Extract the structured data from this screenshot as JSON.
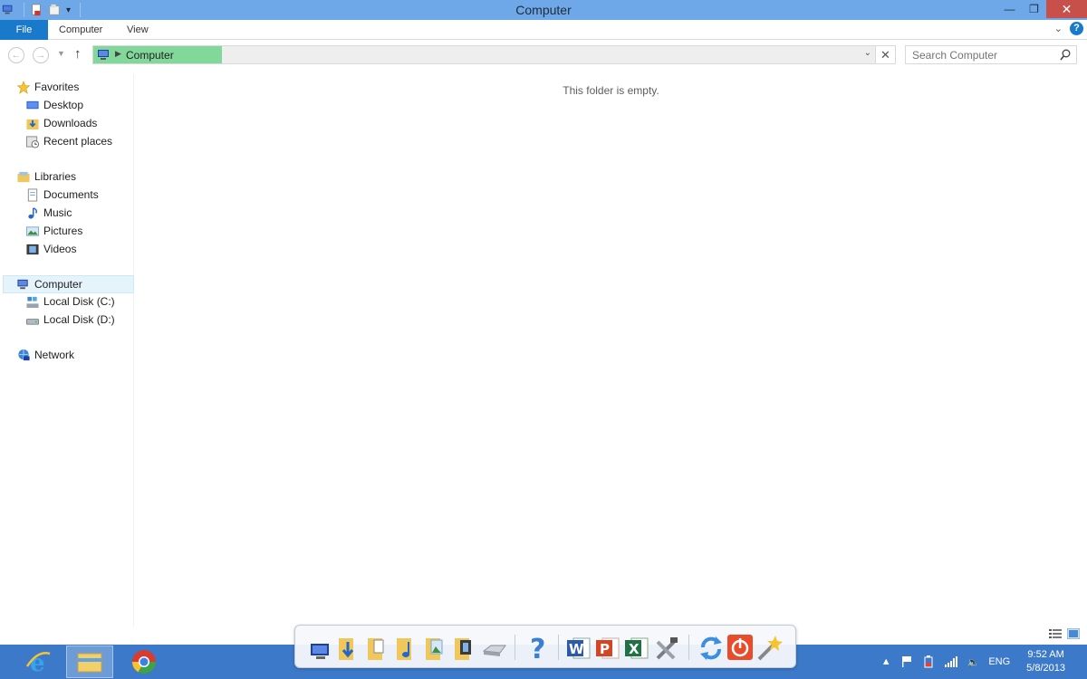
{
  "window": {
    "title": "Computer"
  },
  "ribbon": {
    "file_label": "File",
    "tabs": [
      {
        "label": "Computer"
      },
      {
        "label": "View"
      }
    ],
    "help_label": "?"
  },
  "address_bar": {
    "path": "Computer",
    "search_placeholder": "Search Computer"
  },
  "nav_pane": {
    "favorites": {
      "label": "Favorites",
      "items": [
        {
          "label": "Desktop"
        },
        {
          "label": "Downloads"
        },
        {
          "label": "Recent places"
        }
      ]
    },
    "libraries": {
      "label": "Libraries",
      "items": [
        {
          "label": "Documents"
        },
        {
          "label": "Music"
        },
        {
          "label": "Pictures"
        },
        {
          "label": "Videos"
        }
      ]
    },
    "computer": {
      "label": "Computer",
      "items": [
        {
          "label": "Local Disk (C:)"
        },
        {
          "label": "Local Disk (D:)"
        }
      ]
    },
    "network": {
      "label": "Network"
    }
  },
  "content": {
    "empty_message": "This folder is empty."
  },
  "taskbar": {
    "language": "ENG",
    "time": "9:52 AM",
    "date": "5/8/2013"
  },
  "colors": {
    "titlebar": "#6fa8e8",
    "file_tab": "#1979ca",
    "close_button": "#c7504b",
    "address_highlight": "#82d79b",
    "taskbar": "#3d79c9"
  }
}
